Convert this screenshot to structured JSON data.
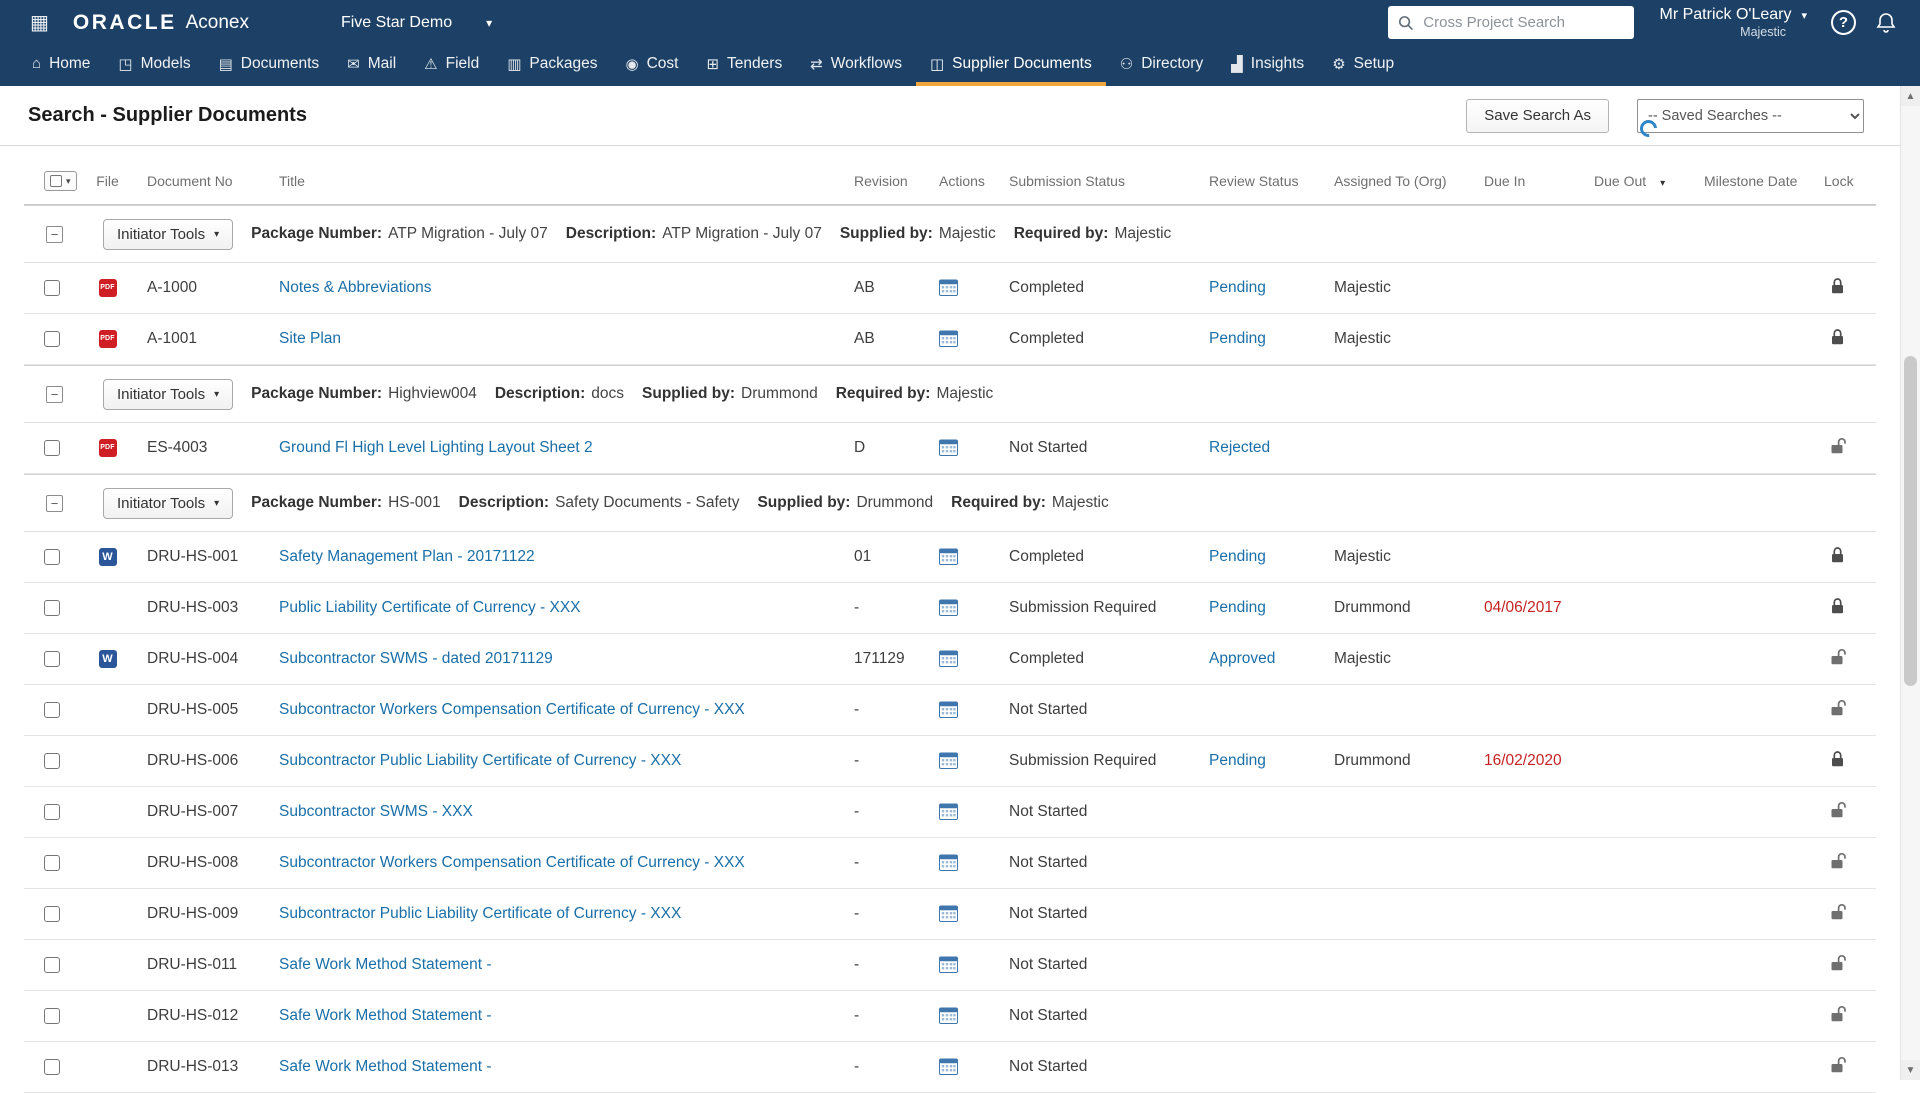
{
  "topbar": {
    "brand": "ORACLE",
    "product": "Aconex",
    "project": "Five Star Demo",
    "search_placeholder": "Cross Project Search",
    "user_name": "Mr Patrick O'Leary",
    "user_org": "Majestic"
  },
  "nav": {
    "items": [
      {
        "label": "Home",
        "icon": "⌂",
        "name": "home",
        "active": false
      },
      {
        "label": "Models",
        "icon": "◳",
        "name": "models",
        "active": false
      },
      {
        "label": "Documents",
        "icon": "▤",
        "name": "documents",
        "active": false
      },
      {
        "label": "Mail",
        "icon": "✉",
        "name": "mail",
        "active": false
      },
      {
        "label": "Field",
        "icon": "⚠",
        "name": "field",
        "active": false
      },
      {
        "label": "Packages",
        "icon": "▥",
        "name": "packages",
        "active": false
      },
      {
        "label": "Cost",
        "icon": "◉",
        "name": "cost",
        "active": false
      },
      {
        "label": "Tenders",
        "icon": "⊞",
        "name": "tenders",
        "active": false
      },
      {
        "label": "Workflows",
        "icon": "⇄",
        "name": "workflows",
        "active": false
      },
      {
        "label": "Supplier Documents",
        "icon": "◫",
        "name": "supplier-documents",
        "active": true
      },
      {
        "label": "Directory",
        "icon": "⚇",
        "name": "directory",
        "active": false
      },
      {
        "label": "Insights",
        "icon": "▟",
        "name": "insights",
        "active": false
      },
      {
        "label": "Setup",
        "icon": "⚙",
        "name": "setup",
        "active": false
      }
    ]
  },
  "page": {
    "title": "Search - Supplier Documents",
    "save_search_button": "Save Search As",
    "saved_searches_placeholder": "-- Saved Searches --"
  },
  "table": {
    "columns": [
      "File",
      "Document No",
      "Title",
      "Revision",
      "Actions",
      "Submission Status",
      "Review Status",
      "Assigned To (Org)",
      "Due In",
      "Due Out",
      "Milestone Date",
      "Lock"
    ],
    "group_labels": {
      "tools_button": "Initiator Tools",
      "package_number": "Package Number:",
      "description": "Description:",
      "supplied_by": "Supplied by:",
      "required_by": "Required by:"
    },
    "groups": [
      {
        "package_number": "ATP Migration - July 07",
        "description": "ATP Migration - July 07",
        "supplied_by": "Majestic",
        "required_by": "Majestic",
        "rows": [
          {
            "file_type": "pdf",
            "doc_no": "A-1000",
            "title": "Notes & Abbreviations",
            "revision": "AB",
            "submission_status": "Completed",
            "review_status": "Pending",
            "assigned_to": "Majestic",
            "due_in": "",
            "locked": true
          },
          {
            "file_type": "pdf",
            "doc_no": "A-1001",
            "title": "Site Plan",
            "revision": "AB",
            "submission_status": "Completed",
            "review_status": "Pending",
            "assigned_to": "Majestic",
            "due_in": "",
            "locked": true
          }
        ]
      },
      {
        "package_number": "Highview004",
        "description": "docs",
        "supplied_by": "Drummond",
        "required_by": "Majestic",
        "rows": [
          {
            "file_type": "pdf",
            "doc_no": "ES-4003",
            "title": "Ground Fl High Level Lighting Layout Sheet 2",
            "revision": "D",
            "submission_status": "Not Started",
            "review_status": "Rejected",
            "assigned_to": "",
            "due_in": "",
            "locked": false
          }
        ]
      },
      {
        "package_number": "HS-001",
        "description": "Safety Documents - Safety",
        "supplied_by": "Drummond",
        "required_by": "Majestic",
        "rows": [
          {
            "file_type": "word",
            "doc_no": "DRU-HS-001",
            "title": "Safety Management Plan - 20171122",
            "revision": "01",
            "submission_status": "Completed",
            "review_status": "Pending",
            "assigned_to": "Majestic",
            "due_in": "",
            "locked": true
          },
          {
            "file_type": null,
            "doc_no": "DRU-HS-003",
            "title": "Public Liability Certificate of Currency - XXX",
            "revision": "-",
            "submission_status": "Submission Required",
            "review_status": "Pending",
            "assigned_to": "Drummond",
            "due_in": "04/06/2017",
            "locked": true
          },
          {
            "file_type": "word",
            "doc_no": "DRU-HS-004",
            "title": "Subcontractor SWMS - dated 20171129",
            "revision": "171129",
            "submission_status": "Completed",
            "review_status": "Approved",
            "assigned_to": "Majestic",
            "due_in": "",
            "locked": false
          },
          {
            "file_type": null,
            "doc_no": "DRU-HS-005",
            "title": "Subcontractor Workers Compensation Certificate of Currency - XXX",
            "revision": "-",
            "submission_status": "Not Started",
            "review_status": "",
            "assigned_to": "",
            "due_in": "",
            "locked": false
          },
          {
            "file_type": null,
            "doc_no": "DRU-HS-006",
            "title": "Subcontractor Public Liability Certificate of Currency - XXX",
            "revision": "-",
            "submission_status": "Submission Required",
            "review_status": "Pending",
            "assigned_to": "Drummond",
            "due_in": "16/02/2020",
            "locked": true
          },
          {
            "file_type": null,
            "doc_no": "DRU-HS-007",
            "title": "Subcontractor SWMS - XXX",
            "revision": "-",
            "submission_status": "Not Started",
            "review_status": "",
            "assigned_to": "",
            "due_in": "",
            "locked": false
          },
          {
            "file_type": null,
            "doc_no": "DRU-HS-008",
            "title": "Subcontractor Workers Compensation Certificate of Currency - XXX",
            "revision": "-",
            "submission_status": "Not Started",
            "review_status": "",
            "assigned_to": "",
            "due_in": "",
            "locked": false
          },
          {
            "file_type": null,
            "doc_no": "DRU-HS-009",
            "title": "Subcontractor Public Liability Certificate of Currency - XXX",
            "revision": "-",
            "submission_status": "Not Started",
            "review_status": "",
            "assigned_to": "",
            "due_in": "",
            "locked": false
          },
          {
            "file_type": null,
            "doc_no": "DRU-HS-011",
            "title": "Safe Work Method Statement -",
            "revision": "-",
            "submission_status": "Not Started",
            "review_status": "",
            "assigned_to": "",
            "due_in": "",
            "locked": false
          },
          {
            "file_type": null,
            "doc_no": "DRU-HS-012",
            "title": "Safe Work Method Statement -",
            "revision": "-",
            "submission_status": "Not Started",
            "review_status": "",
            "assigned_to": "",
            "due_in": "",
            "locked": false
          },
          {
            "file_type": null,
            "doc_no": "DRU-HS-013",
            "title": "Safe Work Method Statement -",
            "revision": "-",
            "submission_status": "Not Started",
            "review_status": "",
            "assigned_to": "",
            "due_in": "",
            "locked": false
          }
        ]
      }
    ]
  },
  "icons": {
    "app_grid": "▦",
    "caret_down": "▾",
    "select_all_caret": "▾",
    "due_out_caret": "▾",
    "help": "?",
    "expand_minus": "−",
    "scroll_up": "▲",
    "scroll_down": "▼",
    "pdf_label": "PDF",
    "word_label": "W"
  },
  "colors": {
    "nav_bg": "#1d4166",
    "active_tab_underline": "#f0a63c",
    "link": "#1a6fa8",
    "overdue_red": "#c62222"
  }
}
